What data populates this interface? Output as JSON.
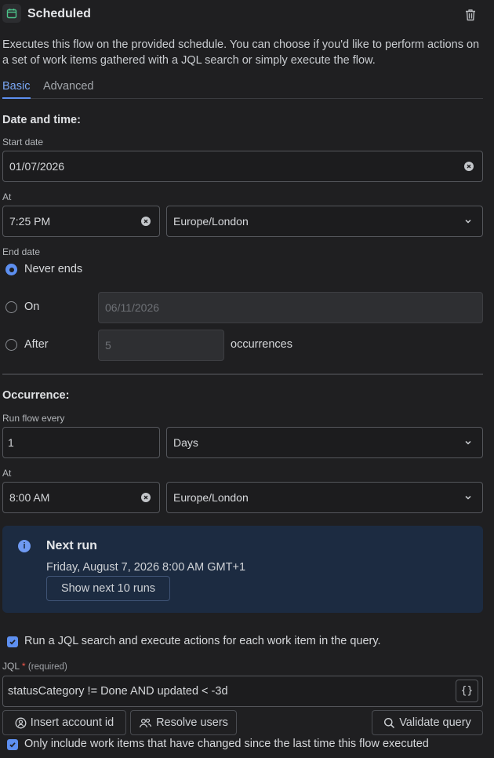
{
  "header": {
    "title": "Scheduled",
    "icon": "calendar-icon",
    "delete_icon": "trash-icon"
  },
  "description": "Executes this flow on the provided schedule. You can choose if you'd like to perform actions on a set of work items gathered with a JQL search or simply execute the flow.",
  "tabs": [
    {
      "label": "Basic",
      "active": true
    },
    {
      "label": "Advanced",
      "active": false
    }
  ],
  "date_time": {
    "heading": "Date and time:",
    "start_date_label": "Start date",
    "start_date": "01/07/2026",
    "at_label": "At",
    "time": "7:25 PM",
    "timezone": "Europe/London",
    "end_date_label": "End date",
    "end_options": {
      "never": "Never ends",
      "on": "On",
      "on_value": "06/11/2026",
      "after": "After",
      "after_value": "5",
      "occurrences": "occurrences",
      "selected": "never"
    }
  },
  "occurrence": {
    "heading": "Occurrence:",
    "run_every_label": "Run flow every",
    "run_every_value": "1",
    "unit": "Days",
    "at_label": "At",
    "time": "8:00 AM",
    "timezone": "Europe/London"
  },
  "next_run": {
    "title": "Next run",
    "text": "Friday, August 7, 2026 8:00 AM GMT+1",
    "button": "Show next 10 runs"
  },
  "jql": {
    "checkbox_label": "Run a JQL search and execute actions for each work item in the query.",
    "label": "JQL",
    "required_star": "*",
    "required_text": "(required)",
    "value": "statusCategory != Done AND updated < -3d",
    "braces": "{}",
    "insert_account": "Insert account id",
    "resolve_users": "Resolve users",
    "validate": "Validate query",
    "only_changed_label": "Only include work items that have changed since the last time this flow executed"
  },
  "colors": {
    "accent": "#5d8ff0",
    "background": "#1f1f21",
    "info_bg": "#1c2b41",
    "required": "#f0564b"
  }
}
